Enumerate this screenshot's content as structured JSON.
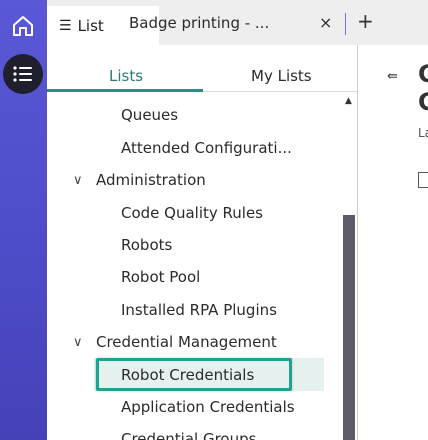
{
  "tabs": {
    "active_label": "List",
    "second_label": "Badge printing - ...",
    "close_glyph": "×",
    "add_glyph": "+"
  },
  "panel": {
    "tab_lists": "Lists",
    "tab_my_lists": "My Lists"
  },
  "tree": {
    "queues": "Queues",
    "attended_config": "Attended Configurati...",
    "administration": "Administration",
    "code_quality_rules": "Code Quality Rules",
    "robots": "Robots",
    "robot_pool": "Robot Pool",
    "installed_rpa_plugins": "Installed RPA Plugins",
    "credential_management": "Credential Management",
    "robot_credentials": "Robot Credentials",
    "application_credentials": "Application Credentials",
    "credential_groups": "Credential Groups"
  },
  "content": {
    "title_line1": "C",
    "title_line2": "C",
    "subtitle": "La"
  },
  "colors": {
    "rail": "#5a58d6",
    "accent": "#2e8b85",
    "selected_border": "#1fa38f"
  }
}
